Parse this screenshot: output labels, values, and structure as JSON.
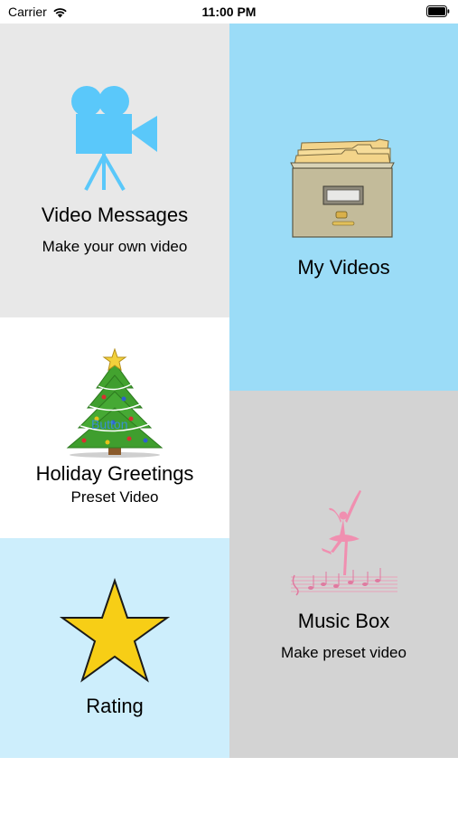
{
  "status_bar": {
    "carrier": "Carrier",
    "time": "11:00 PM"
  },
  "tiles": {
    "video_messages": {
      "title": "Video Messages",
      "subtitle": "Make your own video",
      "icon": "video-camera-icon",
      "background": "#e8e8e8"
    },
    "my_videos": {
      "title": "My Videos",
      "icon": "file-cabinet-icon",
      "background": "#9bdcf7"
    },
    "holiday_greetings": {
      "title": "Holiday Greetings",
      "subtitle": "Preset Video",
      "icon": "christmas-tree-icon",
      "overlay_button": "Button",
      "background": "#ffffff"
    },
    "rating": {
      "title": "Rating",
      "icon": "star-icon",
      "background": "#cdeefc"
    },
    "music_box": {
      "title": "Music Box",
      "subtitle": "Make preset video",
      "icon": "ballerina-icon",
      "background": "#d3d3d3"
    }
  },
  "colors": {
    "camera_blue": "#5ac8fa",
    "star_yellow": "#f7ce16",
    "ballerina_pink": "#f08fb0",
    "tree_green": "#3f9e2e"
  }
}
